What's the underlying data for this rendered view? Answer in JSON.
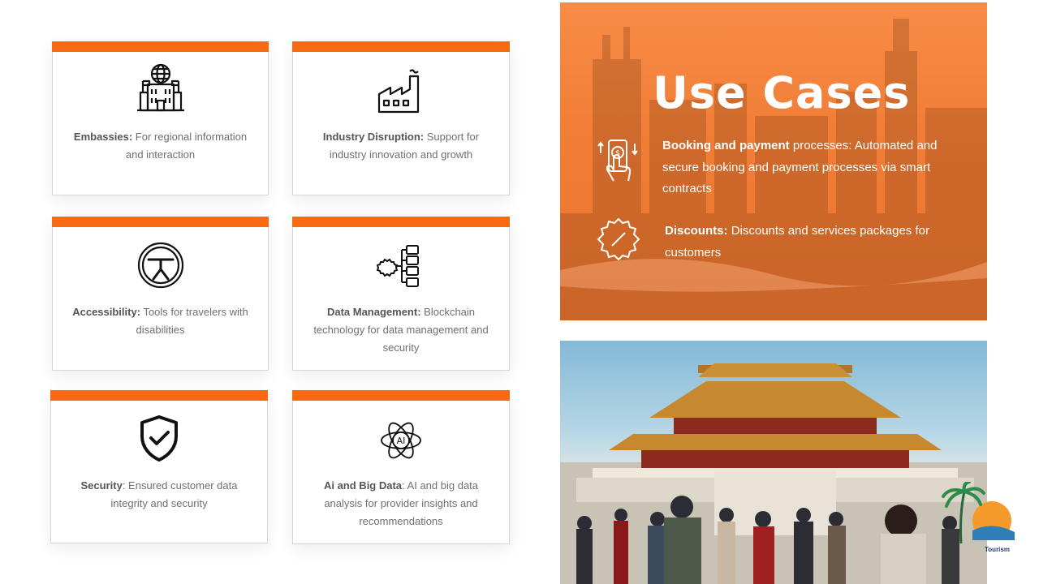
{
  "cards": [
    {
      "icon": "embassy-building-icon",
      "title": "Embassies:",
      "desc": "For regional information and interaction"
    },
    {
      "icon": "factory-icon",
      "title": "Industry Disruption:",
      "desc": "Support for industry innovation and growth"
    },
    {
      "icon": "accessibility-icon",
      "title": "Accessibility:",
      "desc": "Tools for travelers with disabilities"
    },
    {
      "icon": "data-management-icon",
      "title": "Data Management:",
      "desc": "Blockchain technology for data management and security"
    },
    {
      "icon": "shield-check-icon",
      "title": "Security",
      "desc": ": Ensured customer data integrity and security"
    },
    {
      "icon": "ai-atom-icon",
      "title": "Ai and Big Data",
      "desc": ": AI and big data analysis for provider insights and recommendations",
      "icon_text": "AI"
    }
  ],
  "use_cases": {
    "title": "Use Cases",
    "items": [
      {
        "icon": "mobile-payment-icon",
        "title": "Booking and payment",
        "desc": "processes: Automated and secure booking and payment processes via smart contracts"
      },
      {
        "icon": "discount-badge-icon",
        "title": "Discounts:",
        "desc": "Discounts and services packages for customers"
      }
    ]
  },
  "photo": {
    "subject": "forbidden-city-palace-photo"
  },
  "logo": {
    "text": "Tourism"
  },
  "colors": {
    "accent": "#f86a12",
    "panel": "#f07c35",
    "text": "#6f6f6f"
  }
}
